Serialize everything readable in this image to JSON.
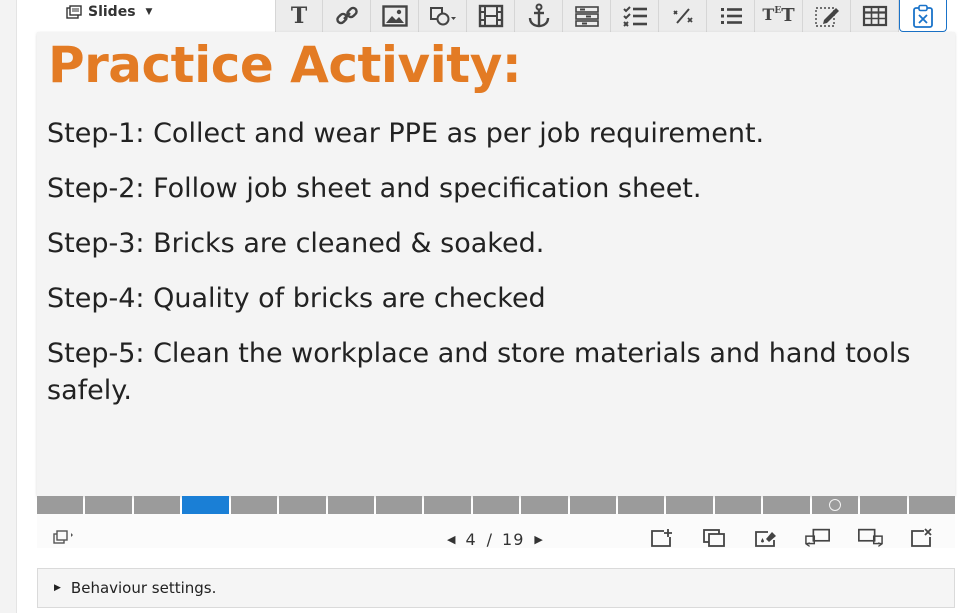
{
  "slides_menu": {
    "label": "Slides"
  },
  "toolbar": {
    "tools": [
      {
        "name": "text-tool",
        "icon": "text-T-icon"
      },
      {
        "name": "link-tool",
        "icon": "link-icon"
      },
      {
        "name": "image-tool",
        "icon": "image-icon"
      },
      {
        "name": "shapes-tool",
        "icon": "shapes-icon"
      },
      {
        "name": "video-tool",
        "icon": "film-icon"
      },
      {
        "name": "anchor-tool",
        "icon": "anchor-icon"
      },
      {
        "name": "summary-tool",
        "icon": "summary-icon"
      },
      {
        "name": "checklist-tool",
        "icon": "checklist-icon"
      },
      {
        "name": "fraction-tool",
        "icon": "fraction-icon"
      },
      {
        "name": "list-tool",
        "icon": "list-icon"
      },
      {
        "name": "text-tt-tool",
        "icon": "text-size-icon"
      },
      {
        "name": "edit-tool",
        "icon": "edit-box-icon"
      },
      {
        "name": "table-tool",
        "icon": "table-icon"
      },
      {
        "name": "clipboard-tool",
        "icon": "clipboard-x-icon"
      }
    ]
  },
  "slide": {
    "title": "Practice Activity:",
    "steps": [
      "Step-1: Collect and wear PPE as per job requirement.",
      "Step-2: Follow job sheet and specification sheet.",
      "Step-3: Bricks are cleaned & soaked.",
      "Step-4: Quality of bricks are checked",
      "Step-5: Clean the workplace and store materials and hand tools safely."
    ],
    "title_color": "#e37b24"
  },
  "progress": {
    "total": 19,
    "current": 4,
    "marked_slide": 17
  },
  "footer": {
    "current": "4",
    "separator": "/",
    "total": "19"
  },
  "behaviour": {
    "label": "Behaviour settings."
  },
  "colors": {
    "accent": "#1a7fd6",
    "segment": "#9b9b9b"
  }
}
